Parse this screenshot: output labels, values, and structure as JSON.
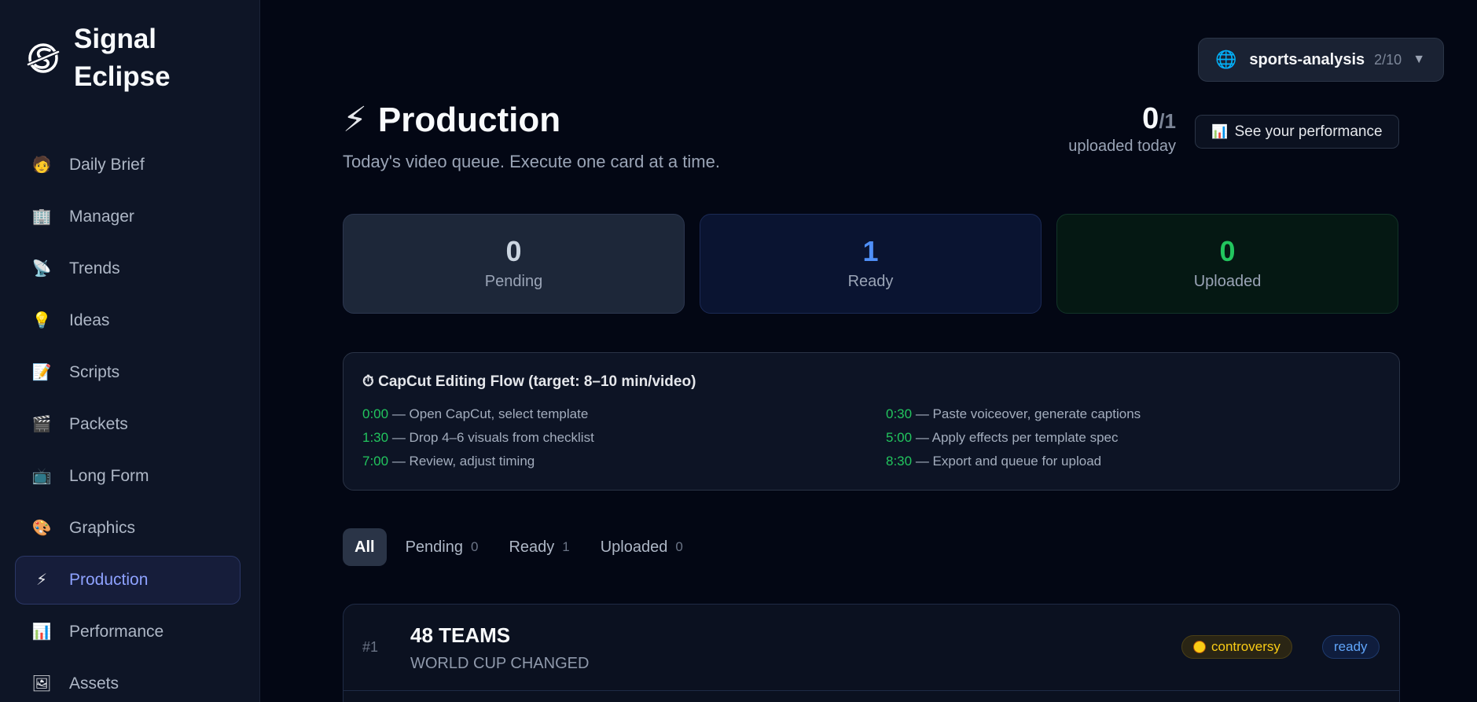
{
  "app": {
    "name": "Signal Eclipse"
  },
  "sidebar": {
    "items": [
      {
        "icon": "🧑",
        "label": "Daily Brief"
      },
      {
        "icon": "🏢",
        "label": "Manager"
      },
      {
        "icon": "📡",
        "label": "Trends"
      },
      {
        "icon": "💡",
        "label": "Ideas"
      },
      {
        "icon": "📝",
        "label": "Scripts"
      },
      {
        "icon": "🎬",
        "label": "Packets"
      },
      {
        "icon": "📺",
        "label": "Long Form"
      },
      {
        "icon": "🎨",
        "label": "Graphics"
      },
      {
        "icon": "⚡",
        "label": "Production",
        "active": true
      },
      {
        "icon": "📊",
        "label": "Performance"
      },
      {
        "icon": "🖼",
        "label": "Assets"
      }
    ]
  },
  "workspace": {
    "name": "sports-analysis",
    "count": "2/10"
  },
  "header": {
    "icon": "⚡",
    "title": "Production",
    "subtitle": "Today's video queue. Execute one card at a time.",
    "uploaded_count": "0",
    "uploaded_total": "/1",
    "uploaded_label": "uploaded today",
    "performance_button": "See your performance",
    "performance_icon": "📊"
  },
  "stats": {
    "pending": {
      "value": "0",
      "label": "Pending"
    },
    "ready": {
      "value": "1",
      "label": "Ready"
    },
    "uploaded": {
      "value": "0",
      "label": "Uploaded"
    }
  },
  "flow": {
    "title": "⏱ CapCut Editing Flow (target: 8–10 min/video)",
    "steps": [
      {
        "time": "0:00",
        "text": "— Open CapCut, select template"
      },
      {
        "time": "0:30",
        "text": "— Paste voiceover, generate captions"
      },
      {
        "time": "1:30",
        "text": "— Drop 4–6 visuals from checklist"
      },
      {
        "time": "5:00",
        "text": "— Apply effects per template spec"
      },
      {
        "time": "7:00",
        "text": "— Review, adjust timing"
      },
      {
        "time": "8:30",
        "text": "— Export and queue for upload"
      }
    ]
  },
  "filters": [
    {
      "label": "All",
      "count": ""
    },
    {
      "label": "Pending",
      "count": "0"
    },
    {
      "label": "Ready",
      "count": "1"
    },
    {
      "label": "Uploaded",
      "count": "0"
    }
  ],
  "cards": [
    {
      "index": "#1",
      "title": "48 TEAMS",
      "subtitle": "WORLD CUP CHANGED",
      "tag": "controversy",
      "status": "ready"
    }
  ]
}
